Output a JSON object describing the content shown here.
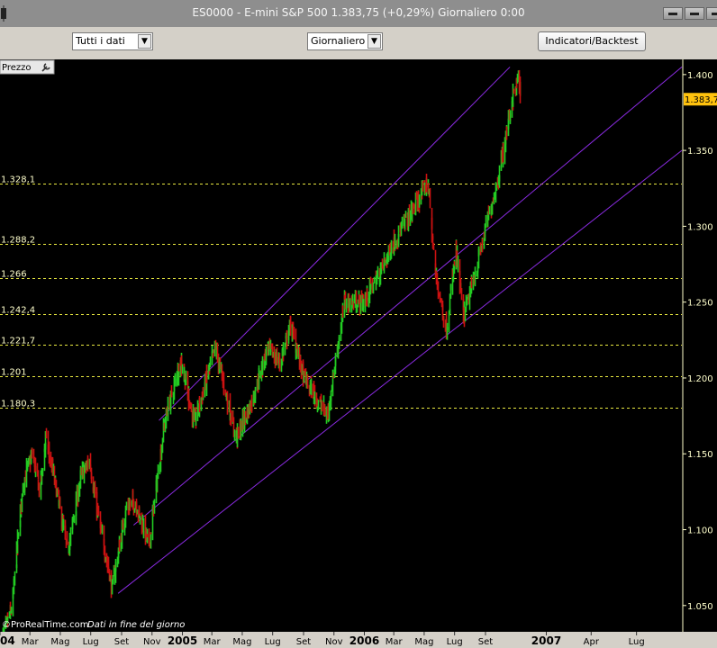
{
  "window": {
    "title": "ES0000 - E-mini S&P 500   1.383,75 (+0,29%)   Giornaliero  0:00"
  },
  "toolbar": {
    "data_select": "Tutti i dati",
    "period_select": "Giornaliero",
    "indicators_button": "Indicatori/Backtest"
  },
  "panel": {
    "label": "Prezzo",
    "footer_brand": "©ProRealTime.com",
    "footer_note": "Dati in fine del giorno"
  },
  "colors": {
    "up": "#22cc22",
    "down": "#cc1111",
    "channel": "#8a2be2",
    "level_line": "#e8e840",
    "axis_text": "#ffffcc",
    "price_tag": "#ffc20e",
    "background": "#000000",
    "panel_bg": "#d4d0c8"
  },
  "chart_data": {
    "type": "candlestick",
    "title": "ES0000 - E-mini S&P 500",
    "x_range": [
      "2004-01-01",
      "2007-09-30"
    ],
    "ylim": [
      1022,
      1410
    ],
    "grid": false,
    "y_ticks": [
      "1.050",
      "1.100",
      "1.150",
      "1.200",
      "1.250",
      "1.300",
      "1.350",
      "1.400"
    ],
    "x_ticks": [
      {
        "date": "2004-01-01",
        "label": "2004",
        "bold": true
      },
      {
        "date": "2004-03-01",
        "label": "Mar"
      },
      {
        "date": "2004-05-01",
        "label": "Mag"
      },
      {
        "date": "2004-07-01",
        "label": "Lug"
      },
      {
        "date": "2004-09-01",
        "label": "Set"
      },
      {
        "date": "2004-11-01",
        "label": "Nov"
      },
      {
        "date": "2005-01-01",
        "label": "2005",
        "bold": true
      },
      {
        "date": "2005-03-01",
        "label": "Mar"
      },
      {
        "date": "2005-05-01",
        "label": "Mag"
      },
      {
        "date": "2005-07-01",
        "label": "Lug"
      },
      {
        "date": "2005-09-01",
        "label": "Set"
      },
      {
        "date": "2005-11-01",
        "label": "Nov"
      },
      {
        "date": "2006-01-01",
        "label": "2006",
        "bold": true
      },
      {
        "date": "2006-03-01",
        "label": "Mar"
      },
      {
        "date": "2006-05-01",
        "label": "Mag"
      },
      {
        "date": "2006-07-01",
        "label": "Lug"
      },
      {
        "date": "2006-09-01",
        "label": "Set"
      },
      {
        "date": "2007-01-01",
        "label": "2007",
        "bold": true
      },
      {
        "date": "2007-04-01",
        "label": "Apr"
      },
      {
        "date": "2007-07-01",
        "label": "Lug"
      }
    ],
    "horizontal_levels": [
      {
        "value": 1328.1,
        "label": "1.328,1"
      },
      {
        "value": 1288.2,
        "label": "1.288,2"
      },
      {
        "value": 1266,
        "label": "1.266"
      },
      {
        "value": 1242.4,
        "label": "1.242,4"
      },
      {
        "value": 1221.7,
        "label": "1.221,7"
      },
      {
        "value": 1201,
        "label": "1.201"
      },
      {
        "value": 1180.3,
        "label": "1.180,3"
      }
    ],
    "channel_lines": [
      {
        "name": "upper",
        "x1": "2004-11-15",
        "y1": 1172,
        "x2": "2006-10-20",
        "y2": 1405
      },
      {
        "name": "middle",
        "x1": "2004-09-25",
        "y1": 1103,
        "x2": "2007-09-30",
        "y2": 1405
      },
      {
        "name": "lower",
        "x1": "2004-08-25",
        "y1": 1058,
        "x2": "2007-09-30",
        "y2": 1350
      }
    ],
    "last_price": {
      "value": 1383.75,
      "label": "1.383,7"
    },
    "anchors": [
      {
        "date": "2004-01-02",
        "close": 1025
      },
      {
        "date": "2004-01-25",
        "close": 1050
      },
      {
        "date": "2004-02-15",
        "close": 1130
      },
      {
        "date": "2004-03-05",
        "close": 1150
      },
      {
        "date": "2004-03-20",
        "close": 1125
      },
      {
        "date": "2004-04-01",
        "close": 1160
      },
      {
        "date": "2004-04-20",
        "close": 1130
      },
      {
        "date": "2004-05-15",
        "close": 1085
      },
      {
        "date": "2004-06-10",
        "close": 1135
      },
      {
        "date": "2004-06-28",
        "close": 1145
      },
      {
        "date": "2004-07-20",
        "close": 1100
      },
      {
        "date": "2004-08-12",
        "close": 1062
      },
      {
        "date": "2004-09-10",
        "close": 1115
      },
      {
        "date": "2004-09-28",
        "close": 1118
      },
      {
        "date": "2004-10-25",
        "close": 1090
      },
      {
        "date": "2004-11-25",
        "close": 1170
      },
      {
        "date": "2004-12-28",
        "close": 1212
      },
      {
        "date": "2005-01-24",
        "close": 1170
      },
      {
        "date": "2005-03-07",
        "close": 1220
      },
      {
        "date": "2005-04-18",
        "close": 1160
      },
      {
        "date": "2005-05-20",
        "close": 1185
      },
      {
        "date": "2005-06-20",
        "close": 1220
      },
      {
        "date": "2005-07-15",
        "close": 1210
      },
      {
        "date": "2005-08-05",
        "close": 1235
      },
      {
        "date": "2005-09-01",
        "close": 1200
      },
      {
        "date": "2005-10-18",
        "close": 1175
      },
      {
        "date": "2005-11-21",
        "close": 1250
      },
      {
        "date": "2005-12-30",
        "close": 1250
      },
      {
        "date": "2006-01-25",
        "close": 1265
      },
      {
        "date": "2006-03-01",
        "close": 1290
      },
      {
        "date": "2006-04-20",
        "close": 1318
      },
      {
        "date": "2006-05-08",
        "close": 1330
      },
      {
        "date": "2006-05-22",
        "close": 1270
      },
      {
        "date": "2006-06-14",
        "close": 1232
      },
      {
        "date": "2006-07-03",
        "close": 1285
      },
      {
        "date": "2006-07-18",
        "close": 1240
      },
      {
        "date": "2006-08-10",
        "close": 1268
      },
      {
        "date": "2006-09-05",
        "close": 1305
      },
      {
        "date": "2006-09-25",
        "close": 1330
      },
      {
        "date": "2006-10-25",
        "close": 1385
      },
      {
        "date": "2006-11-06",
        "close": 1398
      },
      {
        "date": "2006-11-09",
        "close": 1383.75
      }
    ]
  }
}
